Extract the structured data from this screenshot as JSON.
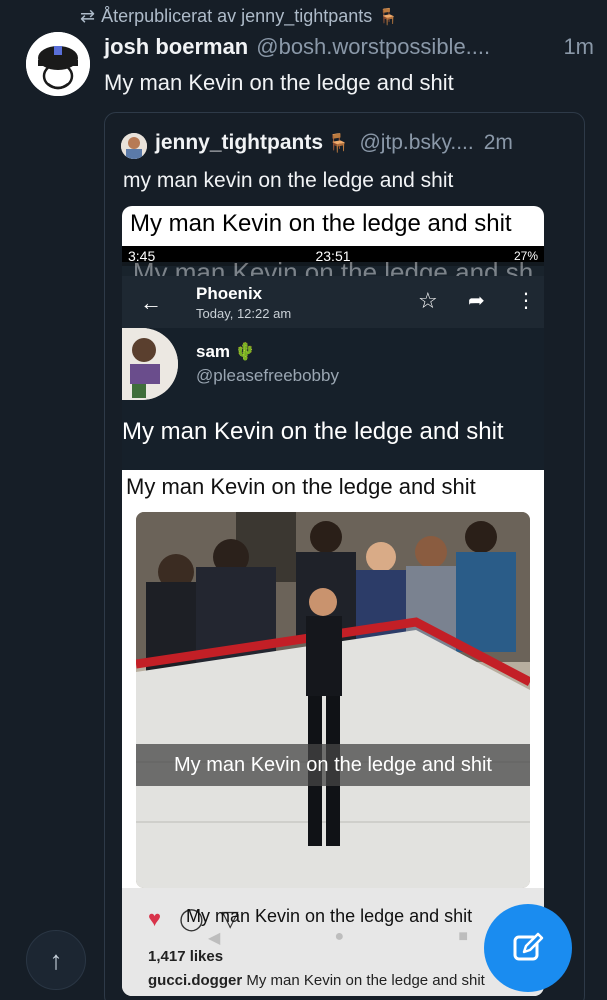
{
  "repost": {
    "icon": "repost-icon",
    "text": "Återpublicerat av jenny_tightpants"
  },
  "post": {
    "author_name": "josh boerman",
    "author_handle": "@bosh.worstpossible....",
    "time": "1m",
    "text": "My man Kevin on the ledge and shit"
  },
  "quote": {
    "author_name": "jenny_tightpants",
    "author_handle": "@jtp.bsky....",
    "time": "2m",
    "text": "my man kevin on the ledge and shit"
  },
  "meme": {
    "top_caption": "My man Kevin on the ledge and shit",
    "status_time_left": "3:45",
    "status_time_center": "23:51",
    "status_right": "27%",
    "ghost_text": "My man Kevin on the ledge and sh",
    "app_title": "Phoenix",
    "app_subtitle": "Today, 12:22 am",
    "tweet_author": "sam",
    "tweet_handle": "@pleasefreebobby",
    "tweet_text": "My man Kevin on the ledge and shit",
    "inner_title": "My man Kevin on the ledge and shit",
    "photo_caption": "My man Kevin on the ledge and shit",
    "ig_overlay": "My man Kevin on the ledge and shit",
    "ig_likes": "1,417 likes",
    "ig_user": "gucci.dogger",
    "ig_caption": "My man Kevin on the ledge and shit"
  },
  "colors": {
    "background": "#161e27",
    "accent": "#1a8cf0",
    "muted": "#8a98a8"
  }
}
